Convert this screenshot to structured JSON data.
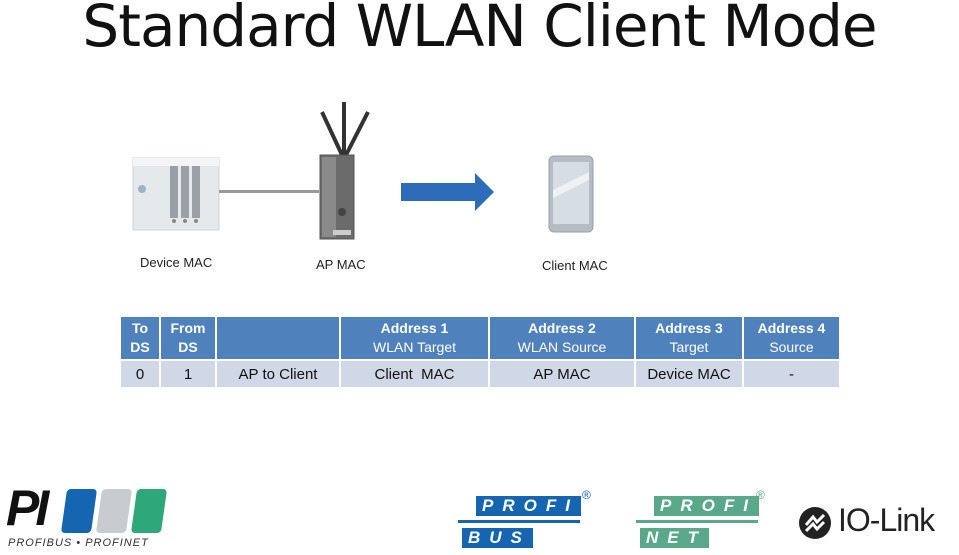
{
  "title": "Standard WLAN Client Mode",
  "devices": {
    "device_label": "Device MAC",
    "ap_label": "AP MAC",
    "client_label": "Client MAC"
  },
  "table": {
    "headers": [
      {
        "line1": "To",
        "line2": "DS"
      },
      {
        "line1": "From",
        "line2": "DS"
      },
      {
        "line1": "",
        "line2": ""
      },
      {
        "line1": "Address 1",
        "line2": "WLAN Target"
      },
      {
        "line1": "Address 2",
        "line2": "WLAN Source"
      },
      {
        "line1": "Address 3",
        "line2": "Target"
      },
      {
        "line1": "Address 4",
        "line2": "Source"
      }
    ],
    "rows": [
      [
        "0",
        "1",
        "AP to Client",
        "Client  MAC",
        "AP MAC",
        "Device MAC",
        "-"
      ]
    ]
  },
  "logos": {
    "pi_text": "PI",
    "pi_sub": "PROFIBUS • PROFINET",
    "profibus_top": "PROFI",
    "profibus_bottom": "BUS",
    "profinet_top": "PROFI",
    "profinet_bottom": "NET",
    "iolink": "IO-Link",
    "registered": "®"
  },
  "colors": {
    "header_bg": "#4f81bd",
    "cell_bg": "#d0d8e8",
    "arrow": "#2e6bb8",
    "pi_blue": "#1565b0",
    "pi_gray": "#c8cbd0",
    "pi_green": "#2ea77a",
    "profinet_green": "#5aa88a"
  }
}
